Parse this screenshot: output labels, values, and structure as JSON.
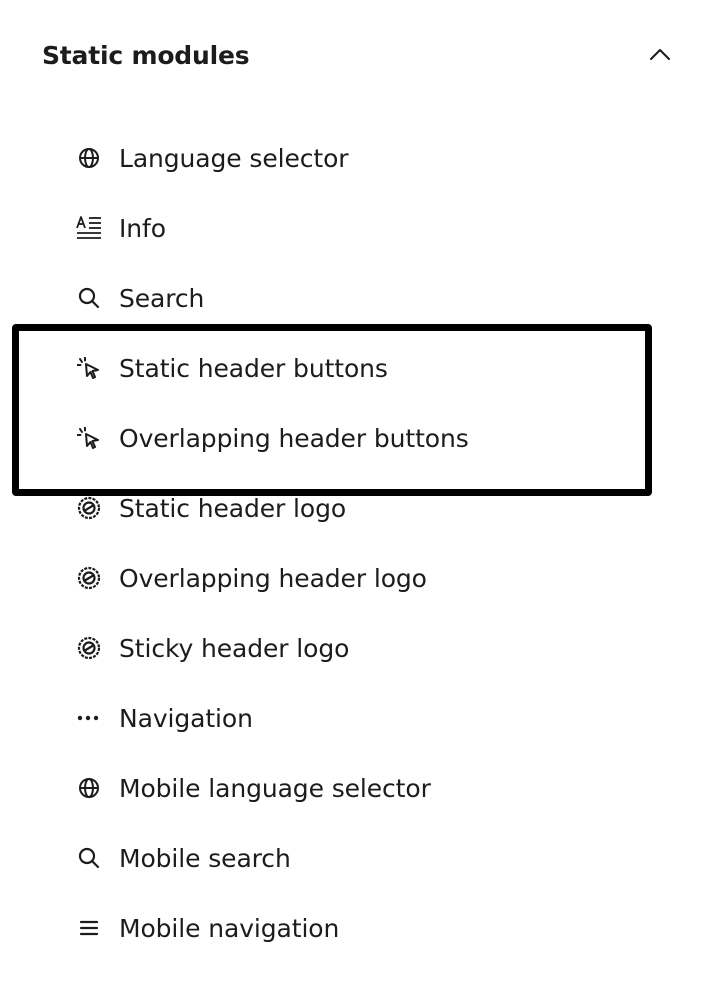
{
  "section": {
    "title": "Static modules",
    "collapse_icon": "chevron-up-icon"
  },
  "items": [
    {
      "label": "Language selector",
      "icon": "globe-icon"
    },
    {
      "label": "Info",
      "icon": "text-info-icon"
    },
    {
      "label": "Search",
      "icon": "search-icon"
    },
    {
      "label": "Static header buttons",
      "icon": "cursor-click-icon"
    },
    {
      "label": "Overlapping header buttons",
      "icon": "cursor-click-icon"
    },
    {
      "label": "Static header logo",
      "icon": "logo-badge-icon"
    },
    {
      "label": "Overlapping header logo",
      "icon": "logo-badge-icon"
    },
    {
      "label": "Sticky header logo",
      "icon": "logo-badge-icon"
    },
    {
      "label": "Navigation",
      "icon": "ellipsis-icon"
    },
    {
      "label": "Mobile language selector",
      "icon": "globe-icon"
    },
    {
      "label": "Mobile search",
      "icon": "search-icon"
    },
    {
      "label": "Mobile navigation",
      "icon": "hamburger-menu-icon"
    }
  ],
  "highlight": {
    "items": [
      "Static header buttons",
      "Overlapping header buttons"
    ],
    "color": "#000000"
  },
  "colors": {
    "text": "#1c1c1c",
    "background": "#ffffff"
  }
}
